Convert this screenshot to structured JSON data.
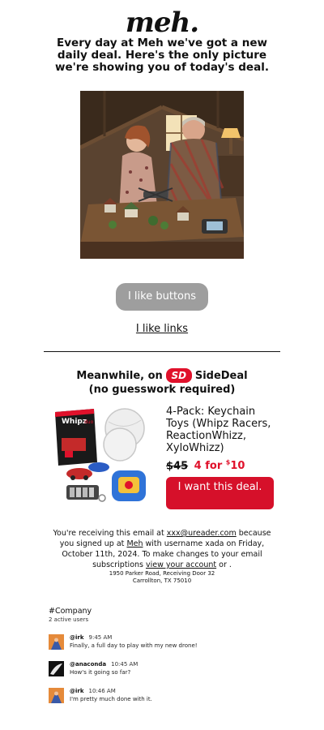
{
  "logo": "meh.",
  "headline": "Every day at Meh we've got a new daily deal. Here's the only picture we're showing you of today's deal.",
  "photo": {
    "icon": "deal-photo-illustration"
  },
  "buttons": {
    "like_buttons": "I like buttons",
    "like_links": "I like links"
  },
  "sidedeal": {
    "prefix": "Meanwhile, on",
    "badge": "SD",
    "name": "SideDeal",
    "subtitle": "(no guesswork required)",
    "product_title": "4-Pack: Keychain Toys (Whipz Racers, ReactionWhizz, XyloWhizz)",
    "price_old": "$45",
    "price_new_prefix": "4 for ",
    "price_new_sup": "$",
    "price_new_value": "10",
    "cta": "I want this deal.",
    "accent_color": "#e0112b"
  },
  "footer": {
    "line_start": "You're receiving this email at ",
    "email": "xxx@ureader.com",
    "line_mid": " because you signed up at ",
    "site": "Meh",
    "line_mid2": " with username xada on Friday, October 11th, 2024. To make changes to your email subscriptions ",
    "account_link": "view your account",
    "line_end": " or ."
  },
  "address": {
    "line1": "1950 Parker Road, Receiving Door 32",
    "line2": "Carrollton, TX 75010"
  },
  "chat": {
    "channel": "#Company",
    "users": "2 active users",
    "messages": [
      {
        "user": "@irk",
        "time": "9:45 AM",
        "text": "Finally, a full day to play with my new drone!"
      },
      {
        "user": "@anaconda",
        "time": "10:45 AM",
        "text": "How's it going so far?"
      },
      {
        "user": "@irk",
        "time": "10:46 AM",
        "text": "I'm pretty much done with it."
      }
    ]
  }
}
